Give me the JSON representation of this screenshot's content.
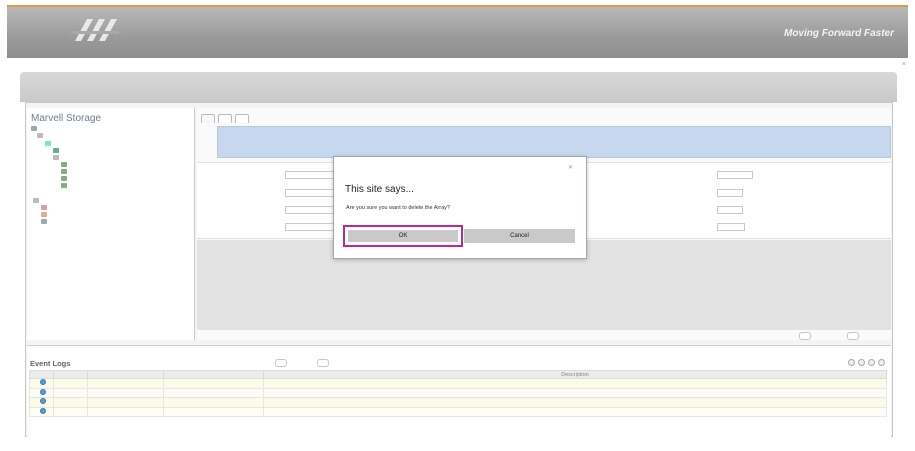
{
  "colors": {
    "banner_accent": "#e29a4a",
    "selection_blue": "#3d6fc9",
    "dialog_highlight": "#c2268e",
    "slogan_accent": "#f08a3c"
  },
  "banner": {
    "logo_icon": "company-logo-icon",
    "logo_text": "",
    "slogan_accent": "",
    "slogan": "Moving Forward Faster"
  },
  "breadcrumb": {
    "prefix": "",
    "items": [
      "",
      ""
    ]
  },
  "tree": {
    "title": "Marvell Storage",
    "items": [
      "",
      "",
      "",
      "",
      "",
      "",
      "",
      "",
      "",
      "",
      "",
      "",
      ""
    ]
  },
  "content": {
    "tabs": [
      "",
      "",
      ""
    ],
    "info_line": "",
    "sub_line": "",
    "mini_buttons": [
      "",
      "",
      ""
    ],
    "left_props": [
      {
        "label": "",
        "value": ""
      },
      {
        "label": "",
        "value": ""
      },
      {
        "label": "",
        "value": ""
      },
      {
        "label": "",
        "value": ""
      }
    ],
    "right_props": [
      {
        "label": "",
        "value": ""
      },
      {
        "label": "",
        "value": ""
      },
      {
        "label": "",
        "value": ""
      },
      {
        "label": "",
        "value": ""
      }
    ],
    "bottom_buttons": [
      "",
      ""
    ]
  },
  "event_log": {
    "title": "Event Logs",
    "subtitle": "",
    "buttons": [
      "",
      ""
    ],
    "columns": [
      "",
      "",
      "",
      "",
      "Description"
    ],
    "rows": [
      {
        "adapter": "",
        "class": "",
        "time": "",
        "description": ""
      },
      {
        "adapter": "",
        "class": "",
        "time": "",
        "description": ""
      },
      {
        "adapter": "",
        "class": "",
        "time": "",
        "description": ""
      },
      {
        "adapter": "",
        "class": "",
        "time": "",
        "description": ""
      }
    ]
  },
  "dialog": {
    "title": "This site says...",
    "message": "Are you sure you want to delete the Array?",
    "ok_label": "OK",
    "cancel_label": "Cancel",
    "close_icon": "close-icon"
  }
}
